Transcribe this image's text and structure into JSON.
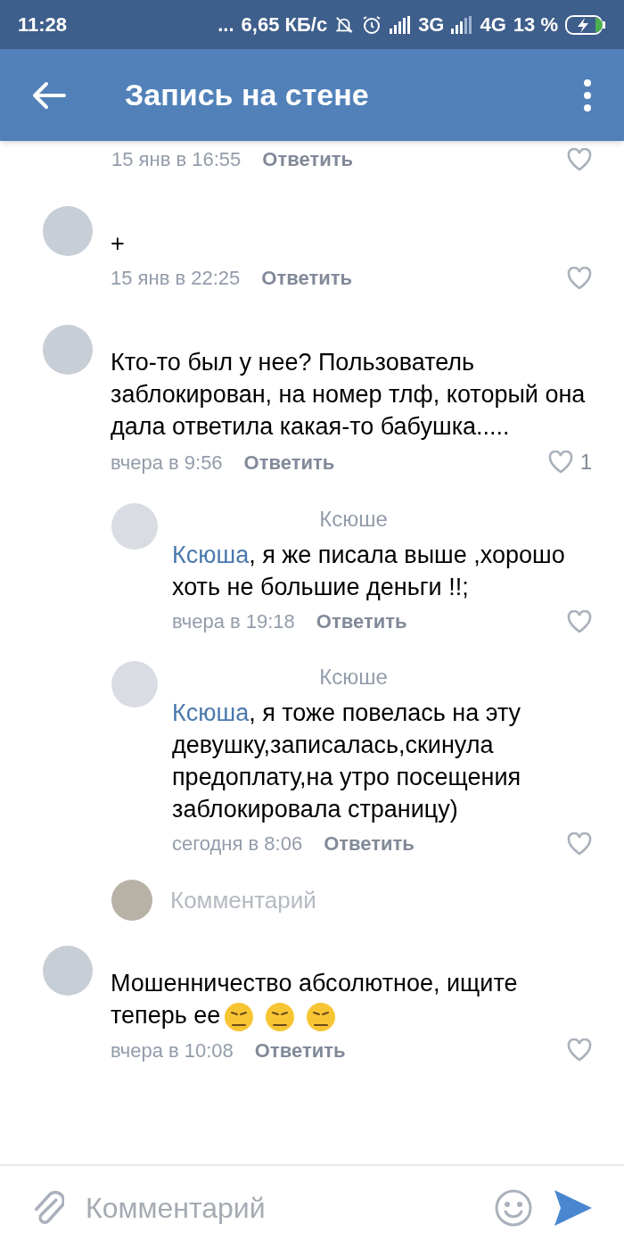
{
  "status_bar": {
    "time": "11:28",
    "dots": "...",
    "speed": "6,65 КБ/с",
    "network_1": "3G",
    "network_2": "4G",
    "battery": "13 %"
  },
  "header": {
    "title": "Запись на стене"
  },
  "comments": [
    {
      "kind": "meta_only",
      "time": "15 янв в 16:55",
      "reply_label": "Ответить"
    },
    {
      "kind": "comment",
      "text": "+",
      "time": "15 янв в 22:25",
      "reply_label": "Ответить"
    },
    {
      "kind": "comment",
      "text": "Кто-то был у нее? Пользователь заблокирован, на номер тлф, который она дала ответила какая-то бабушка.....",
      "time": "вчера в 9:56",
      "reply_label": "Ответить",
      "likes": "1"
    },
    {
      "kind": "reply",
      "addressee": "Ксюше",
      "mention": "Ксюша",
      "text": ", я же писала выше ,хорошо хоть не большие деньги !!;",
      "time": "вчера в 19:18",
      "reply_label": "Ответить"
    },
    {
      "kind": "reply",
      "addressee": "Ксюше",
      "mention": "Ксюша",
      "text": ", я тоже повелась на эту девушку,записалась,скинула предоплату,на утро посещения заблокировала страницу)",
      "time": "сегодня в 8:06",
      "reply_label": "Ответить"
    },
    {
      "kind": "reply_field",
      "placeholder": "Комментарий"
    },
    {
      "kind": "comment",
      "text": "Мошенничество абсолютное, ищите теперь ее",
      "reaction_icons": true,
      "time": "вчера в 10:08",
      "reply_label": "Ответить"
    }
  ],
  "composer": {
    "placeholder": "Комментарий"
  }
}
